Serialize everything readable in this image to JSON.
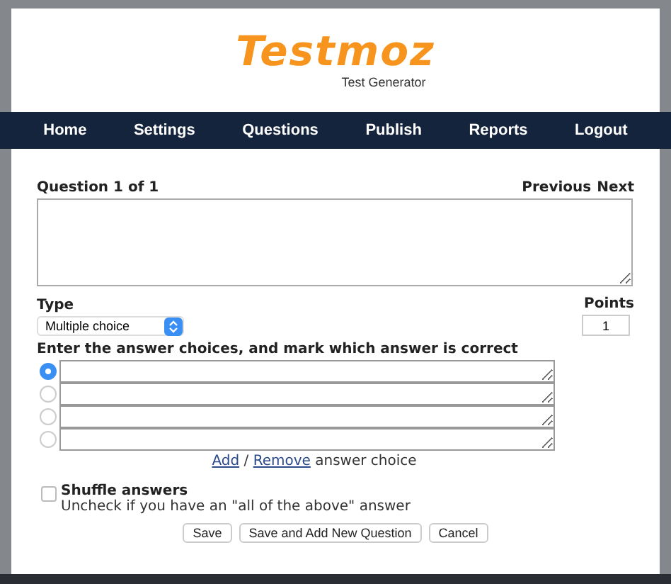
{
  "logo": {
    "title": "Testmoz",
    "tagline": "Test Generator"
  },
  "nav": [
    {
      "label": "Home"
    },
    {
      "label": "Settings"
    },
    {
      "label": "Questions"
    },
    {
      "label": "Publish"
    },
    {
      "label": "Reports"
    },
    {
      "label": "Logout"
    }
  ],
  "question": {
    "heading": "Question 1 of 1",
    "previous": "Previous",
    "next": "Next"
  },
  "type": {
    "label": "Type",
    "value": "Multiple choice"
  },
  "points": {
    "label": "Points",
    "value": "1"
  },
  "answers": {
    "label": "Enter the answer choices, and mark which answer is correct",
    "choices": [
      {
        "selected": true
      },
      {
        "selected": false
      },
      {
        "selected": false
      },
      {
        "selected": false
      }
    ],
    "add": "Add",
    "separator": "/",
    "remove": "Remove",
    "suffix": "answer choice"
  },
  "shuffle": {
    "label": "Shuffle answers",
    "checked": false,
    "hint": "Uncheck if you have an \"all of the above\" answer"
  },
  "buttons": [
    {
      "label": "Save"
    },
    {
      "label": "Save and Add New Question"
    },
    {
      "label": "Cancel"
    }
  ]
}
